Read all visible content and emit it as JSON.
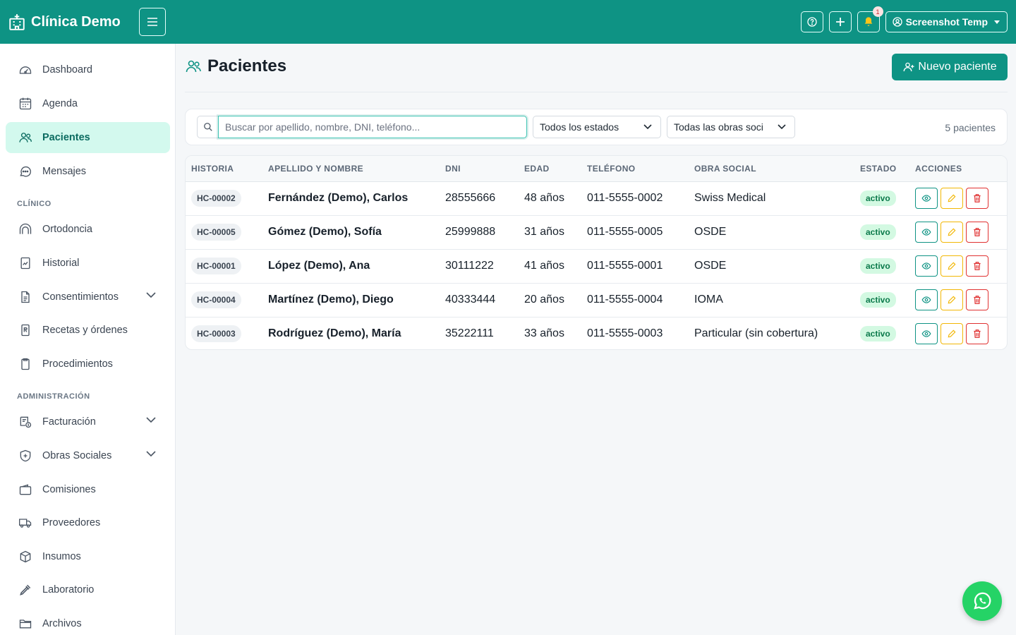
{
  "brand": {
    "name": "Clínica Demo"
  },
  "topbar": {
    "notification_count": "1",
    "user_name": "Screenshot Temp"
  },
  "sidebar": {
    "items": [
      {
        "label": "Dashboard",
        "icon": "dashboard-icon"
      },
      {
        "label": "Agenda",
        "icon": "calendar-icon"
      },
      {
        "label": "Pacientes",
        "icon": "users-icon",
        "active": true
      },
      {
        "label": "Mensajes",
        "icon": "chat-icon"
      }
    ],
    "section_clinico": "CLÍNICO",
    "clinico_items": [
      {
        "label": "Ortodoncia",
        "icon": "tooth-icon"
      },
      {
        "label": "Historial",
        "icon": "file-chart-icon"
      },
      {
        "label": "Consentimientos",
        "icon": "file-text-icon",
        "expandable": true
      },
      {
        "label": "Recetas y órdenes",
        "icon": "prescription-icon"
      },
      {
        "label": "Procedimientos",
        "icon": "clipboard-icon"
      }
    ],
    "section_admin": "ADMINISTRACIÓN",
    "admin_items": [
      {
        "label": "Facturación",
        "icon": "invoice-icon",
        "expandable": true
      },
      {
        "label": "Obras Sociales",
        "icon": "shield-icon",
        "expandable": true
      },
      {
        "label": "Comisiones",
        "icon": "wallet-icon"
      },
      {
        "label": "Proveedores",
        "icon": "truck-icon"
      },
      {
        "label": "Insumos",
        "icon": "box-icon"
      },
      {
        "label": "Laboratorio",
        "icon": "pipette-icon"
      },
      {
        "label": "Archivos",
        "icon": "folder-icon"
      }
    ]
  },
  "main": {
    "title": "Pacientes",
    "new_button": "Nuevo paciente",
    "search_placeholder": "Buscar por apellido, nombre, DNI, teléfono...",
    "filter_estado": "Todos los estados",
    "filter_obra": "Todas las obras soci",
    "count_text": "5 pacientes",
    "columns": [
      "HISTORIA",
      "APELLIDO Y NOMBRE",
      "DNI",
      "EDAD",
      "TELÉFONO",
      "OBRA SOCIAL",
      "ESTADO",
      "ACCIONES"
    ],
    "rows": [
      {
        "hc": "HC-00002",
        "name": "Fernández (Demo), Carlos",
        "dni": "28555666",
        "edad": "48 años",
        "tel": "011-5555-0002",
        "obra": "Swiss Medical",
        "estado": "activo"
      },
      {
        "hc": "HC-00005",
        "name": "Gómez (Demo), Sofía",
        "dni": "25999888",
        "edad": "31 años",
        "tel": "011-5555-0005",
        "obra": "OSDE",
        "estado": "activo"
      },
      {
        "hc": "HC-00001",
        "name": "López (Demo), Ana",
        "dni": "30111222",
        "edad": "41 años",
        "tel": "011-5555-0001",
        "obra": "OSDE",
        "estado": "activo"
      },
      {
        "hc": "HC-00004",
        "name": "Martínez (Demo), Diego",
        "dni": "40333444",
        "edad": "20 años",
        "tel": "011-5555-0004",
        "obra": "IOMA",
        "estado": "activo"
      },
      {
        "hc": "HC-00003",
        "name": "Rodríguez (Demo), María",
        "dni": "35222111",
        "edad": "33 años",
        "tel": "011-5555-0003",
        "obra": "Particular (sin cobertura)",
        "estado": "activo"
      }
    ]
  },
  "colors": {
    "primary": "#0e9384",
    "active_bg": "#d3f9ee",
    "whatsapp": "#25d366"
  }
}
